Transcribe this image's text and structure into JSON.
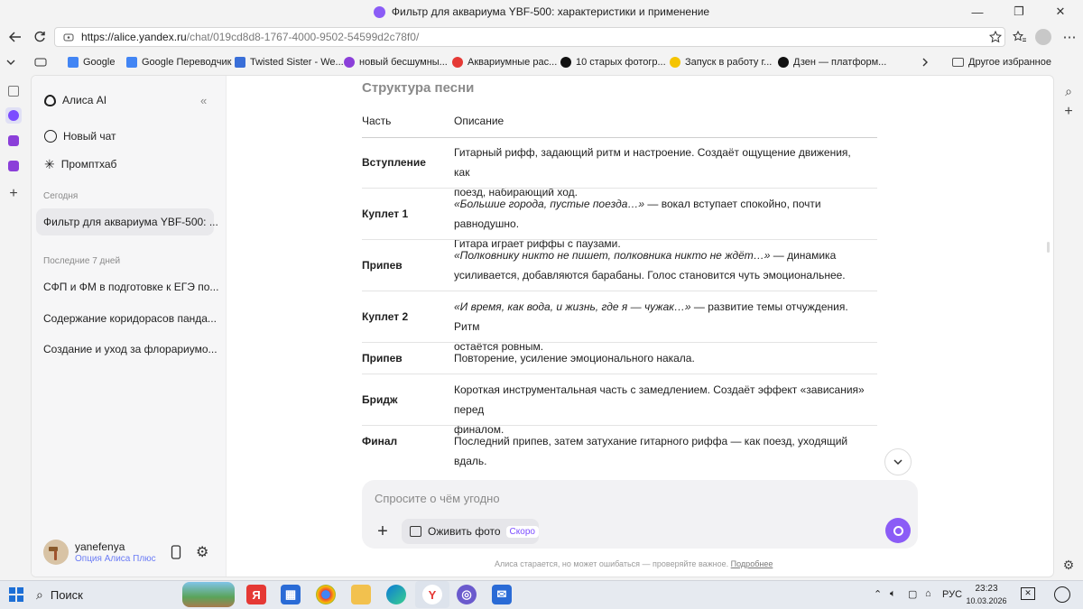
{
  "window": {
    "title": "Фильтр для аквариума YBF-500: характеристики и применение",
    "controls": [
      "—",
      "❐",
      "✕"
    ]
  },
  "addressbar": {
    "url_host": "https://alice.yandex.ru",
    "url_path": "/chat/019cd8d8-1767-4000-9502-54599d2c78f0/"
  },
  "bookmarks": [
    {
      "label": "Google",
      "color": "#4285f4"
    },
    {
      "label": "Google Переводчик",
      "color": "#4285f4"
    },
    {
      "label": "Twisted Sister - We...",
      "color": "#3a6fd8"
    },
    {
      "label": "новый бесшумны...",
      "color": "#8b3fd9"
    },
    {
      "label": "Аквариумные рас...",
      "color": "#e53935"
    },
    {
      "label": "10 старых фотогр...",
      "color": "#111111"
    },
    {
      "label": "Запуск в работу г...",
      "color": "#f5c400"
    },
    {
      "label": "Дзен — платформ...",
      "color": "#111111"
    }
  ],
  "bookmarks_other": "Другое избранное",
  "sidebar": {
    "app_name": "Алиса AI",
    "new_chat": "Новый чат",
    "prompthub": "Промптхаб",
    "section_today": "Сегодня",
    "active_chat": "Фильтр для аквариума YBF-500: ...",
    "section_week": "Последние 7 дней",
    "history": [
      "СФП и ФМ в подготовке к ЕГЭ по...",
      "Содержание коридорасов панда...",
      "Создание и уход за флорариумо..."
    ],
    "user_name": "yanefenya",
    "user_plan": "Опция Алиса Плюс"
  },
  "content": {
    "heading": "Структура песни",
    "col_part": "Часть",
    "col_desc": "Описание",
    "rows": [
      {
        "part": "Вступление",
        "desc_a": "Гитарный рифф, задающий ритм и настроение. Создаёт ощущение движения, как",
        "desc_b": "поезд, набирающий ход."
      },
      {
        "part": "Куплет 1",
        "desc_a_italic": "«Большие города, пустые поезда…»",
        "desc_a_rest": " — вокал вступает спокойно, почти равнодушно.",
        "desc_b": "Гитара играет риффы с паузами."
      },
      {
        "part": "Припев",
        "desc_a_italic": "«Полковнику никто не пишет, полковника никто не ждёт…»",
        "desc_a_rest": " — динамика",
        "desc_b": "усиливается, добавляются барабаны. Голос становится чуть эмоциональнее."
      },
      {
        "part": "Куплет 2",
        "desc_a_italic": "«И время, как вода, и жизнь, где я — чужак…»",
        "desc_a_rest": " — развитие темы отчуждения. Ритм",
        "desc_b": "остаётся ровным."
      },
      {
        "part": "Припев",
        "desc_a": "Повторение, усиление эмоционального накала.",
        "desc_b": ""
      },
      {
        "part": "Бридж",
        "desc_a": "Короткая инструментальная часть с замедлением. Создаёт эффект «зависания» перед",
        "desc_b": "финалом."
      },
      {
        "part": "Финал",
        "desc_a": "Последний припев, затем затухание гитарного риффа — как поезд, уходящий вдаль.",
        "desc_b": ""
      }
    ]
  },
  "composer": {
    "placeholder": "Спросите о чём угодно",
    "animate_photo": "Оживить фото",
    "soon_badge": "Скоро",
    "disclaimer": "Алиса старается, но может ошибаться — проверяйте важное.",
    "more_link": "Подробнее"
  },
  "taskbar": {
    "search": "Поиск",
    "lang": "РУС",
    "time": "23:23",
    "date": "10.03.2026"
  },
  "colors": {
    "accent": "#8b5cf6",
    "panel": "#ffffff",
    "sidebar": "#f6f6f7"
  }
}
